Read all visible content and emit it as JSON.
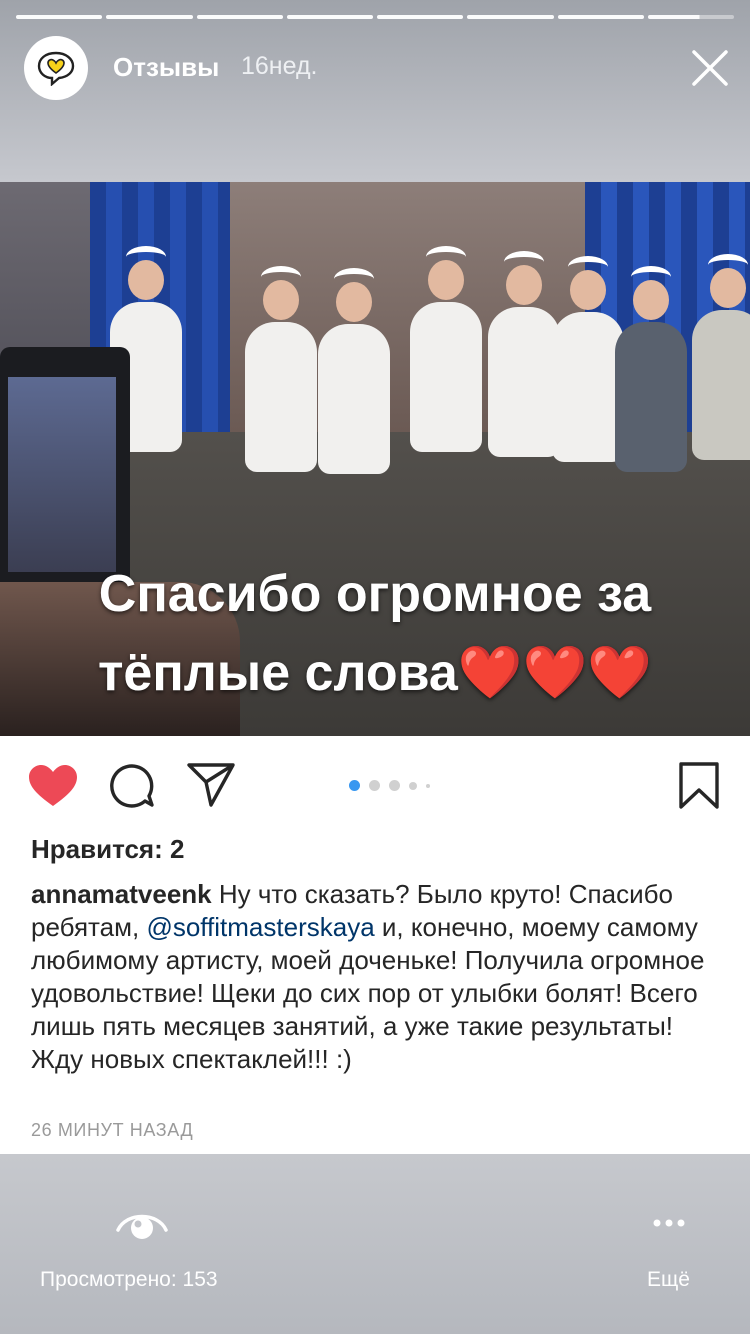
{
  "header": {
    "title": "Отзывы",
    "time": "16нед."
  },
  "story": {
    "segments": 8,
    "active_progress": 0.6,
    "overlay_lines": [
      "Спасибо огромное за",
      "тёплые слова❤️❤️❤️"
    ]
  },
  "post": {
    "likes_text": "Нравится: 2",
    "caption": {
      "username": "annamatveenk",
      "text_before_mention": " Ну что сказать? Было круто! Спасибо ребятам, ",
      "mention": "@soffitmasterskaya",
      "text_after_mention": "  и, конечно, моему самому любимому артисту, моей доченьке! Получила огромное удовольствие! Щеки до сих пор от улыбки болят! Всего лишь пять месяцев занятий, а уже такие результаты! Жду новых спектаклей!!! :)"
    },
    "time_ago": "26 МИНУТ НАЗАД",
    "carousel": {
      "total": 5,
      "active": 1
    }
  },
  "footer": {
    "views_label": "Просмотрено: 153",
    "more_label": "Ещё"
  },
  "colors": {
    "heart": "#ed4956",
    "mention": "#003569",
    "carousel_active": "#3897f0"
  },
  "icons": {
    "like": "heart-icon",
    "comment": "comment-icon",
    "share": "send-icon",
    "save": "bookmark-icon",
    "close": "close-icon",
    "views": "eye-icon",
    "more": "more-dots-icon"
  }
}
